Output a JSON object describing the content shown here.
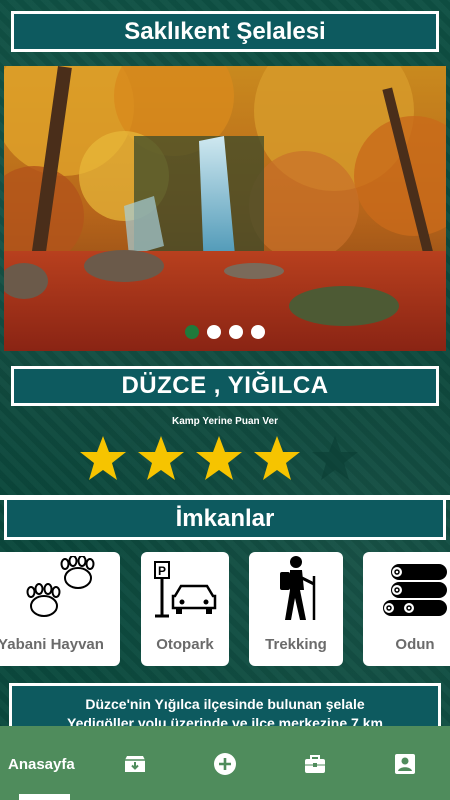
{
  "title": "Saklıkent Şelalesi",
  "carousel": {
    "page_count": 4,
    "active_index": 0
  },
  "location": "DÜZCE , YIĞILCA",
  "rating": {
    "label": "Kamp Yerine Puan Ver",
    "value": 4,
    "max": 5
  },
  "facilities_title": "İmkanlar",
  "facilities": [
    {
      "label": "Yabani Hayvan",
      "icon": "paw-icon"
    },
    {
      "label": "Otopark",
      "icon": "parking-icon"
    },
    {
      "label": "Trekking",
      "icon": "hiker-icon"
    },
    {
      "label": "Odun",
      "icon": "firewood-icon"
    }
  ],
  "description": {
    "line1": "Düzce'nin Yığılca ilçesinde bulunan şelale",
    "line2": "Yedigöller yolu üzerinde ve ilçe merkezine 7 km"
  },
  "bottom_nav": {
    "home_label": "Anasayfa",
    "icons": [
      "archive-icon",
      "add-circle-icon",
      "briefcase-icon",
      "profile-icon"
    ]
  },
  "colors": {
    "bar": "#0d5a5f",
    "nav": "#4f8c5c",
    "star": "#f6c400",
    "dot_active": "#1f7a3b"
  }
}
